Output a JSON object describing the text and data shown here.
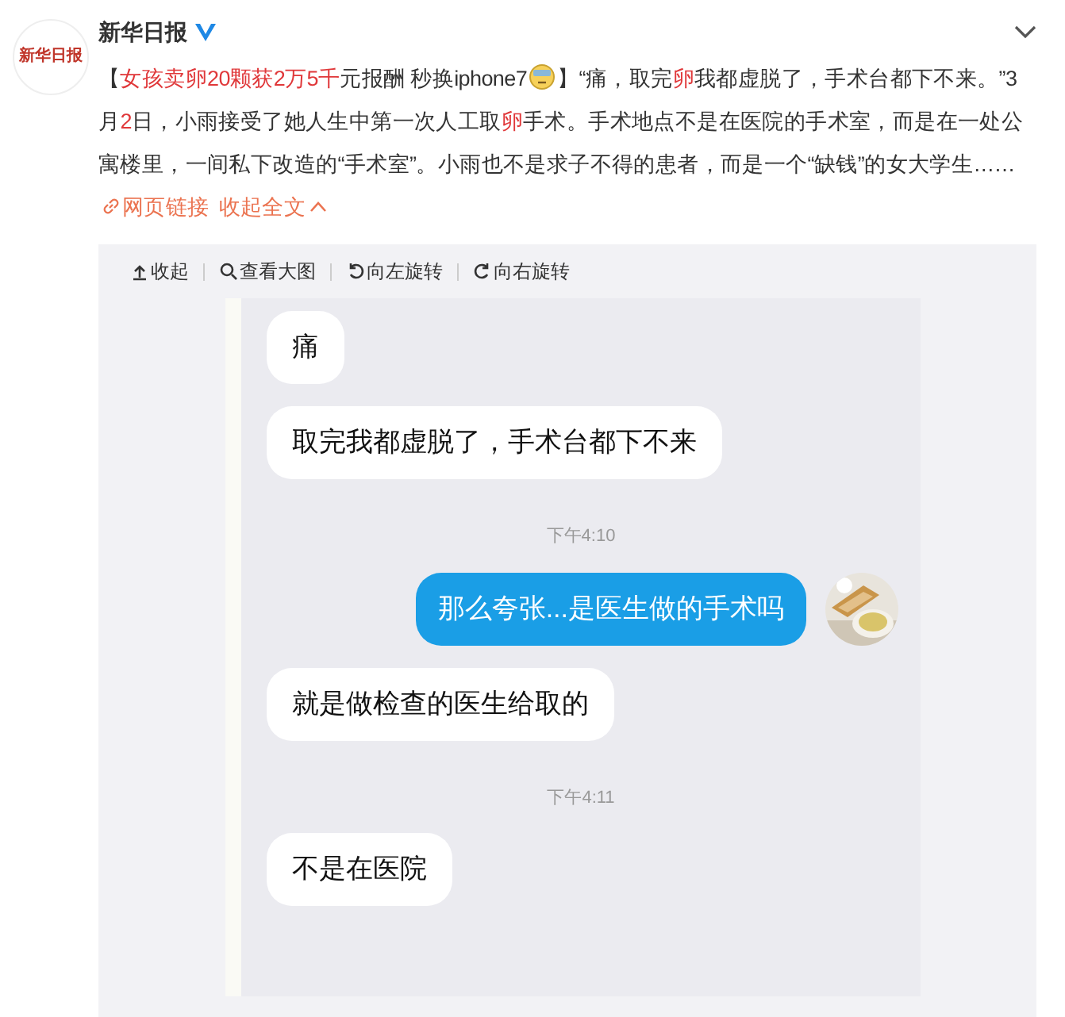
{
  "post": {
    "logo_text": "新华日报",
    "author": "新华日报",
    "verified": true,
    "body": [
      {
        "text": "【",
        "highlight": false
      },
      {
        "text": "女孩卖卵20颗获2万5千",
        "highlight": true
      },
      {
        "text": "元报酬 秒换iphone7",
        "highlight": false
      },
      {
        "kind": "emoji"
      },
      {
        "text": "】“痛，取完",
        "highlight": false
      },
      {
        "text": "卵",
        "highlight": true
      },
      {
        "text": "我都虚脱了，手术台都下不来。”3月",
        "highlight": false
      },
      {
        "text": "2",
        "highlight": true
      },
      {
        "text": "日，小雨接受了她人生中第一次人工取",
        "highlight": false
      },
      {
        "text": "卵",
        "highlight": true
      },
      {
        "text": "手术。手术地点不是在医院的手术室，而是在一处公寓楼里，一间私下改造的“手术室”。小雨也不是求子不得的患者，而是一个“缺钱”的女大学生……",
        "highlight": false
      }
    ],
    "link": "网页链接",
    "collapse": "收起全文"
  },
  "image_toolbar": [
    {
      "kind": "collapse",
      "label": "收起"
    },
    {
      "kind": "zoom",
      "label": "查看大图"
    },
    {
      "kind": "rotate-left",
      "label": "向左旋转"
    },
    {
      "kind": "rotate-right",
      "label": "向右旋转"
    }
  ],
  "chat": [
    {
      "kind": "received",
      "text": "痛"
    },
    {
      "kind": "received",
      "text": "取完我都虚脱了，手术台都下不来"
    },
    {
      "kind": "time",
      "text": "下午4:10"
    },
    {
      "kind": "sent",
      "text": "那么夸张...是医生做的手术吗"
    },
    {
      "kind": "received",
      "text": "就是做检查的医生给取的"
    },
    {
      "kind": "time",
      "text": "下午4:11"
    },
    {
      "kind": "received",
      "text": "不是在医院"
    }
  ]
}
